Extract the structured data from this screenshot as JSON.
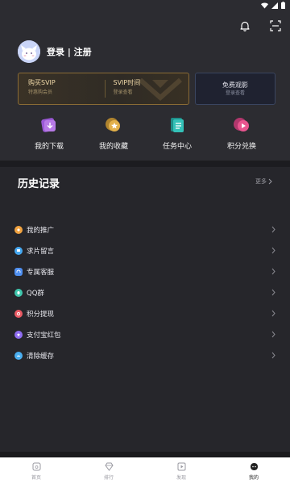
{
  "status_bar": {
    "icons": [
      "wifi-icon",
      "signal-icon",
      "battery-icon"
    ]
  },
  "topbar": {
    "icons": [
      "bell-icon",
      "scan-icon"
    ]
  },
  "profile": {
    "login_register": "登录 | 注册"
  },
  "vip_card": {
    "buy_title": "购买SVIP",
    "buy_sub": "特惠购会员",
    "time_title": "SVIP时间",
    "time_sub": "登录查看"
  },
  "free_card": {
    "title": "免费观影",
    "sub": "登录查看"
  },
  "quick_actions": [
    {
      "label": "我的下载",
      "icon": "download-icon",
      "color": "#9b59d6"
    },
    {
      "label": "我的收藏",
      "icon": "favorite-icon",
      "color": "#d8a23a"
    },
    {
      "label": "任务中心",
      "icon": "task-icon",
      "color": "#2fb7b0"
    },
    {
      "label": "积分兑换",
      "icon": "exchange-icon",
      "color": "#e1528f"
    }
  ],
  "history": {
    "title": "历史记录",
    "more": "更多"
  },
  "menu": [
    {
      "label": "我的推广",
      "icon": "promote-icon",
      "color": "#f1a340"
    },
    {
      "label": "求片留言",
      "icon": "message-icon",
      "color": "#46a8f1"
    },
    {
      "label": "专属客服",
      "icon": "service-icon",
      "color": "#4f8ff0"
    },
    {
      "label": "QQ群",
      "icon": "qq-icon",
      "color": "#3fc6ad"
    },
    {
      "label": "积分提现",
      "icon": "withdraw-icon",
      "color": "#ea5a64"
    },
    {
      "label": "支付宝红包",
      "icon": "alipay-icon",
      "color": "#8e6cf0"
    },
    {
      "label": "清除缓存",
      "icon": "clear-cache-icon",
      "color": "#4aaef0"
    }
  ],
  "tabbar": [
    {
      "label": "首页",
      "icon": "home-icon",
      "active": false
    },
    {
      "label": "排行",
      "icon": "rank-icon",
      "active": false
    },
    {
      "label": "发现",
      "icon": "discover-icon",
      "active": false
    },
    {
      "label": "我的",
      "icon": "mine-icon",
      "active": true
    }
  ]
}
